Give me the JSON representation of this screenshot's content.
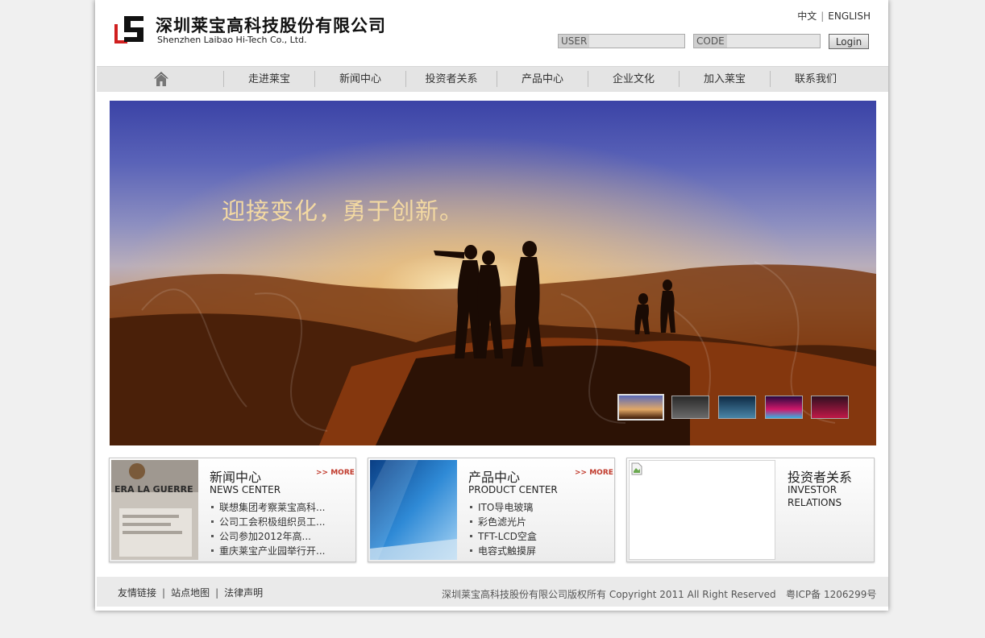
{
  "header": {
    "company_cn": "深圳莱宝高科技股份有限公司",
    "company_en": "Shenzhen Laibao Hi-Tech Co., Ltd.",
    "lang_cn": "中文",
    "lang_en": "ENGLISH",
    "user_placeholder": "USER",
    "code_placeholder": "CODE",
    "login_label": "Login"
  },
  "nav": {
    "items": [
      "走进莱宝",
      "新闻中心",
      "投资者关系",
      "产品中心",
      "企业文化",
      "加入莱宝",
      "联系我们"
    ]
  },
  "banner": {
    "slogan": "迎接变化，勇于创新。",
    "active_thumbnail": 1
  },
  "panels": {
    "news": {
      "title": "新闻中心",
      "subtitle": "NEWS CENTER",
      "more": ">> MORE",
      "image_text": "ERA LA GUERRE",
      "items": [
        "联想集团考察莱宝高科...",
        "公司工会积极组织员工...",
        "公司参加2012年高...",
        "重庆莱宝产业园举行开..."
      ]
    },
    "products": {
      "title": "产品中心",
      "subtitle": "PRODUCT CENTER",
      "more": ">> MORE",
      "items": [
        "ITO导电玻璃",
        "彩色滤光片",
        "TFT-LCD空盒",
        "电容式触摸屏"
      ]
    },
    "investor": {
      "title": "投资者关系",
      "subtitle_line1": "INVESTOR",
      "subtitle_line2": "RELATIONS"
    }
  },
  "footer": {
    "links": [
      "友情链接",
      "站点地图",
      "法律声明"
    ],
    "copyright": "深圳莱宝高科技股份有限公司版权所有 Copyright 2011 All Right Reserved",
    "icp": "粤ICP备 1206299号"
  },
  "colors": {
    "nav_bg": "#e4e4e4",
    "slogan": "#f3d9a2",
    "more_accent": "#c0392b",
    "logo_red": "#d01f1f"
  }
}
